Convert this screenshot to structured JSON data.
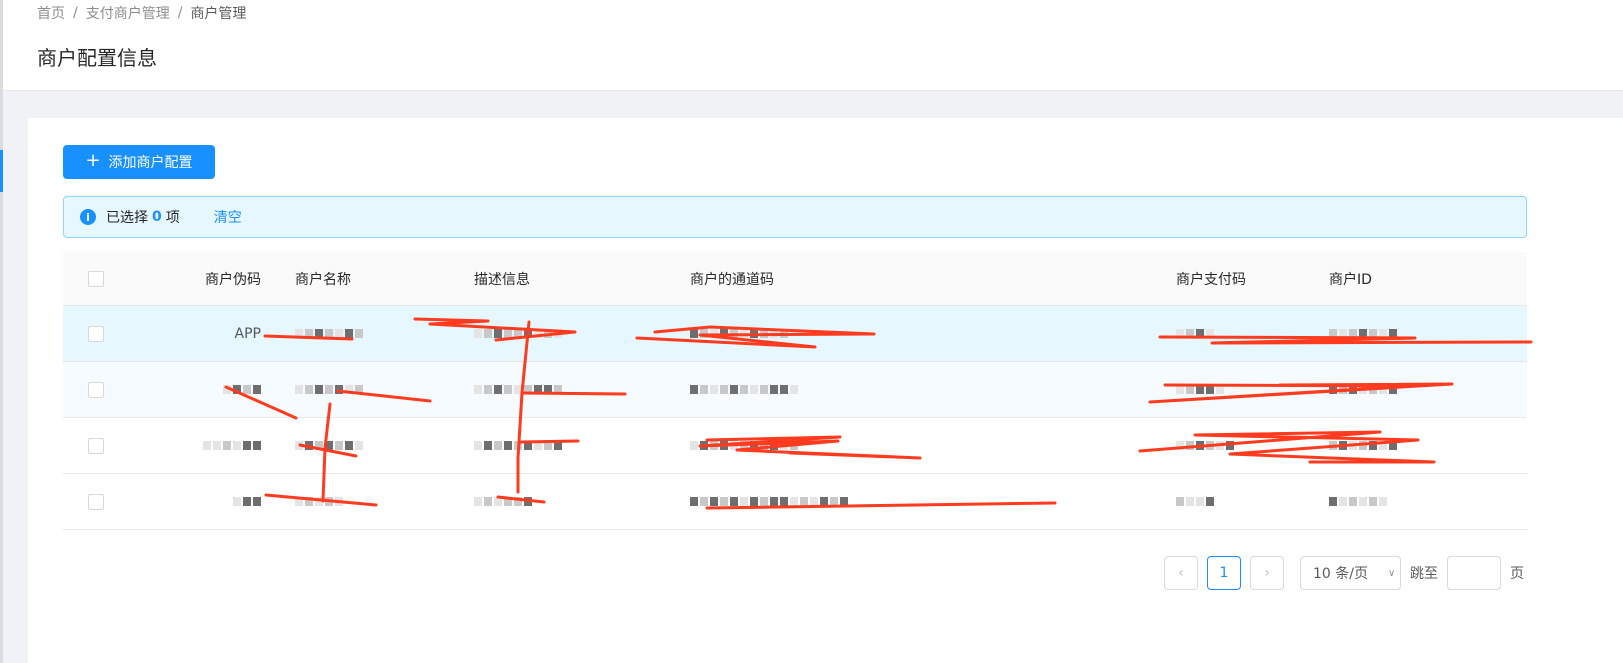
{
  "breadcrumb": {
    "items": [
      "首页",
      "支付商户管理",
      "商户管理"
    ]
  },
  "page_title": "商户配置信息",
  "toolbar": {
    "add_label": "添加商户配置"
  },
  "selection_alert": {
    "prefix": "已选择",
    "count": "0",
    "suffix": "项",
    "clear_label": "清空"
  },
  "table": {
    "columns": [
      "商户伪码",
      "商户名称",
      "描述信息",
      "商户的通道码",
      "商户支付码",
      "商户ID"
    ],
    "rows": [
      {
        "code": "APP"
      },
      {
        "code": ""
      },
      {
        "code": ""
      },
      {
        "code": ""
      }
    ]
  },
  "pagination": {
    "current_page": "1",
    "page_size": "10 条/页",
    "jump_label": "跳至",
    "page_label": "页"
  },
  "colors": {
    "primary": "#1890ff",
    "alert_bg": "#e6f7ff",
    "redaction": "#ff3b1f"
  }
}
